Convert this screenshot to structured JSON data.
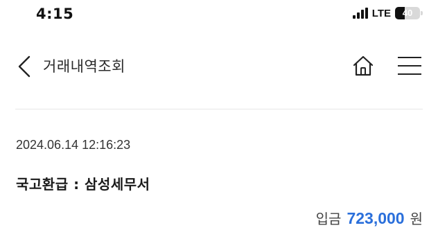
{
  "status_bar": {
    "time": "4:15",
    "network": "LTE",
    "battery_level": "40",
    "battery_fraction": 0.4,
    "icons": [
      "signal-icon",
      "battery-icon"
    ]
  },
  "header": {
    "title": "거래내역조회",
    "icons": [
      "chevron-left-icon",
      "home-icon",
      "hamburger-menu-icon"
    ]
  },
  "transaction": {
    "datetime": "2024.06.14 12:16:23",
    "title": "국고환급 : 삼성세무서",
    "type_label": "입금",
    "amount": "723,000",
    "currency": "원"
  },
  "colors": {
    "amount": "#2a6fdb",
    "divider": "#e6e6e6",
    "text": "#1a1a1a"
  }
}
